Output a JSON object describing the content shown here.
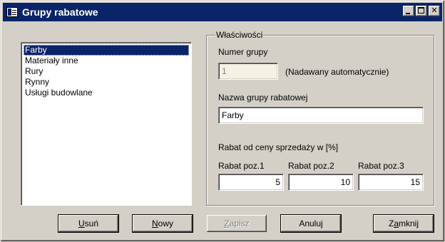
{
  "window": {
    "title": "Grupy rabatowe",
    "minimize_label": "",
    "maximize_label": "",
    "close_label": "✕"
  },
  "groups_list": {
    "items": [
      {
        "label": "Farby",
        "selected": true
      },
      {
        "label": "Materiały inne",
        "selected": false
      },
      {
        "label": "Rury",
        "selected": false
      },
      {
        "label": "Rynny",
        "selected": false
      },
      {
        "label": "Usługi budowlane",
        "selected": false
      }
    ]
  },
  "properties": {
    "legend": "Właściwości",
    "group_number_label": "Numer grupy",
    "group_number_value": "1",
    "auto_note": "(Nadawany automatycznie)",
    "name_label": "Nazwa grupy rabatowej",
    "name_value": "Farby",
    "discount_heading": "Rabat od ceny sprzedaży w [%]",
    "discounts": [
      {
        "label": "Rabat poz.1",
        "value": "5"
      },
      {
        "label": "Rabat poz.2",
        "value": "10"
      },
      {
        "label": "Rabat poz.3",
        "value": "15"
      }
    ]
  },
  "buttons": {
    "delete": {
      "hotkey": "U",
      "rest": "suń"
    },
    "new": {
      "hotkey": "N",
      "rest": "owy"
    },
    "save": {
      "hotkey": "Z",
      "rest": "apisz"
    },
    "cancel": {
      "label": "Anuluj"
    },
    "close": {
      "pre": "Z",
      "hotkey": "a",
      "rest": "mknij"
    }
  },
  "colors": {
    "titlebar": "#0a246a",
    "face": "#d4d0c8",
    "selection": "#0a246a",
    "disabled_field": "#f5f2e3"
  }
}
